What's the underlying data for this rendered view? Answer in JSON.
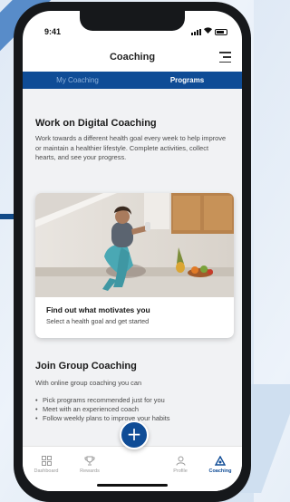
{
  "status_bar": {
    "time": "9:41"
  },
  "header": {
    "title": "Coaching"
  },
  "tabs": [
    {
      "label": "My Coaching",
      "active": false
    },
    {
      "label": "Programs",
      "active": true
    }
  ],
  "digital": {
    "title": "Work on Digital Coaching",
    "description": "Work towards a different health goal every week to help improve or maintain a healthier lifestyle. Complete activities, collect hearts, and see your progress.",
    "card": {
      "title": "Find out what motivates you",
      "description": "Select a health goal and get started"
    }
  },
  "group": {
    "title": "Join Group Coaching",
    "description": "With online group coaching you can",
    "bullets": [
      "Pick programs recommended just for you",
      "Meet with an experienced coach",
      "Follow weekly plans to improve your habits"
    ]
  },
  "bottom_nav": [
    {
      "label": "Dashboard",
      "icon": "dashboard-icon",
      "active": false
    },
    {
      "label": "Rewards",
      "icon": "trophy-icon",
      "active": false
    },
    {
      "label": "Profile",
      "icon": "person-icon",
      "active": false
    },
    {
      "label": "Coaching",
      "icon": "coaching-icon",
      "active": true
    }
  ],
  "fab": {
    "symbol": "+"
  },
  "colors": {
    "primary": "#0f4c96",
    "tab_inactive": "#8fb2dc",
    "content_bg": "#f1f2f4"
  }
}
